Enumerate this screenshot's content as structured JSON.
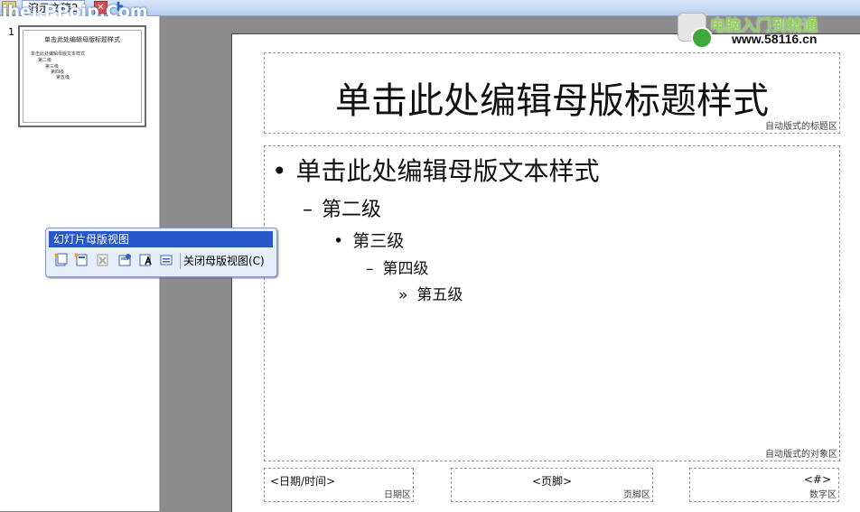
{
  "tabs": {
    "document_title": "演示文稿2",
    "close_glyph": "✕",
    "new_glyph": "✚"
  },
  "watermark_left": "ihei.PPoip.Com",
  "watermark_right": {
    "brand": "电脑入门到精通",
    "url": "www.58116.cn"
  },
  "thumbnail": {
    "slide_number": "1",
    "title": "单击此处编辑母版标题样式",
    "lines": [
      "单击此处编辑母版文本样式",
      "第二级",
      "第三级",
      "第四级",
      "第五级"
    ]
  },
  "slide": {
    "title_text": "单击此处编辑母版标题样式",
    "title_area_label": "自动版式的标题区",
    "levels": [
      {
        "bullet": "•",
        "text": "单击此处编辑母版文本样式"
      },
      {
        "bullet": "–",
        "text": "第二级"
      },
      {
        "bullet": "•",
        "text": "第三级"
      },
      {
        "bullet": "–",
        "text": "第四级"
      },
      {
        "bullet": "»",
        "text": "第五级"
      }
    ],
    "object_area_label": "自动版式的对象区",
    "date_text": "<日期/时间>",
    "date_label": "日期区",
    "footer_text": "<页脚>",
    "footer_label": "页脚区",
    "number_text": "<#>",
    "number_label": "数字区"
  },
  "toolbar": {
    "title": "幻灯片母版视图",
    "icons": [
      "insert-new-slide-master-icon",
      "insert-new-title-master-icon",
      "delete-master-icon",
      "preserve-master-icon",
      "rename-master-icon",
      "master-layout-icon"
    ],
    "close_label": "关闭母版视图(C)"
  },
  "colors": {
    "toolbar_title_bg": "#2857c9",
    "workspace_bg": "#8c8c8c",
    "watermark_green": "#8fcf5a"
  }
}
